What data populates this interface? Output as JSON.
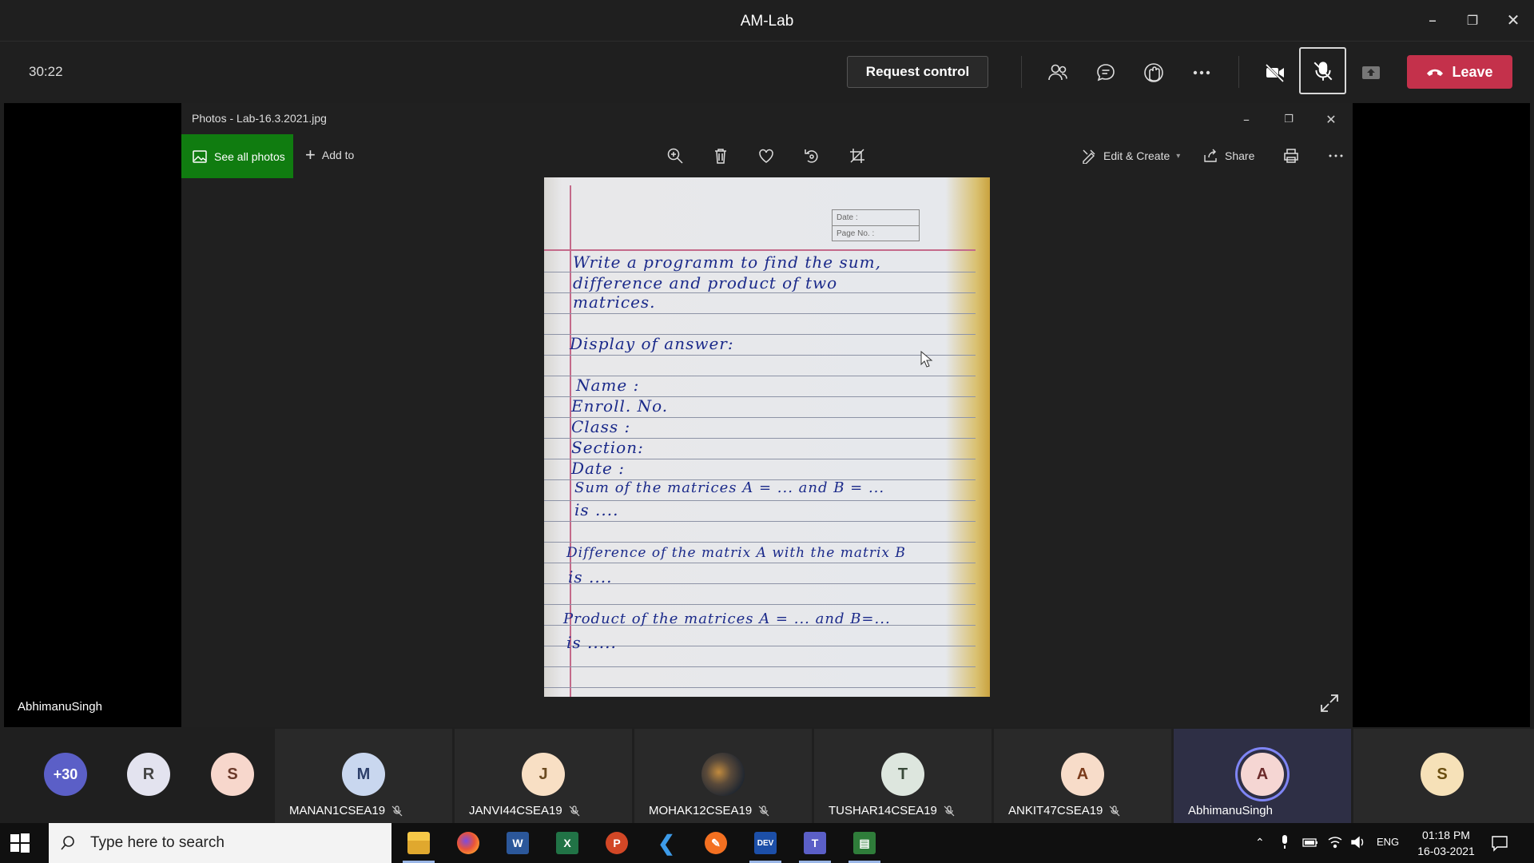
{
  "window": {
    "title": "AM-Lab"
  },
  "toolbar": {
    "timer": "30:22",
    "request_control": "Request control",
    "leave": "Leave"
  },
  "stage": {
    "presenter_name": "AbhimanuSingh"
  },
  "photos": {
    "title": "Photos - Lab-16.3.2021.jpg",
    "see_all": "See all photos",
    "add_to": "Add to",
    "edit_create": "Edit & Create",
    "share": "Share"
  },
  "page": {
    "date_label": "Date :",
    "page_no_label": "Page No. :",
    "lines": [
      "Write a programm to find the sum,",
      "difference and product of two",
      "matrices.",
      "Display of answer:",
      "Name :",
      "Enroll. No.",
      "Class :",
      "Section:",
      "Date :",
      "Sum of the matrices A = ...  and B = ...",
      "is ....",
      "Difference of the matrix A with the matrix B",
      "is ....",
      "Product of the matrices  A = ...  and B=...",
      "is ....."
    ]
  },
  "participants": {
    "overflow": "+30",
    "small": [
      {
        "initial": "R",
        "color": "#e3e3ef"
      },
      {
        "initial": "S",
        "color": "#f7d7cc"
      }
    ],
    "tiles": [
      {
        "initial": "M",
        "name": "MANAN1CSEA19",
        "color": "#c9d7ef"
      },
      {
        "initial": "J",
        "name": "JANVI44CSEA19",
        "color": "#f8dfc4"
      },
      {
        "initial": "",
        "name": "MOHAK12CSEA19",
        "color": "#444"
      },
      {
        "initial": "T",
        "name": "TUSHAR14CSEA19",
        "color": "#dde6de"
      },
      {
        "initial": "A",
        "name": "ANKIT47CSEA19",
        "color": "#f7dcc9"
      },
      {
        "initial": "A",
        "name": "AbhimanuSingh",
        "color": "#f5d6d3"
      }
    ],
    "last": {
      "initial": "S",
      "color": "#f6e1b8"
    }
  },
  "taskbar": {
    "search_placeholder": "Type here to search",
    "lang": "ENG",
    "time": "01:18 PM",
    "date": "16-03-2021"
  }
}
